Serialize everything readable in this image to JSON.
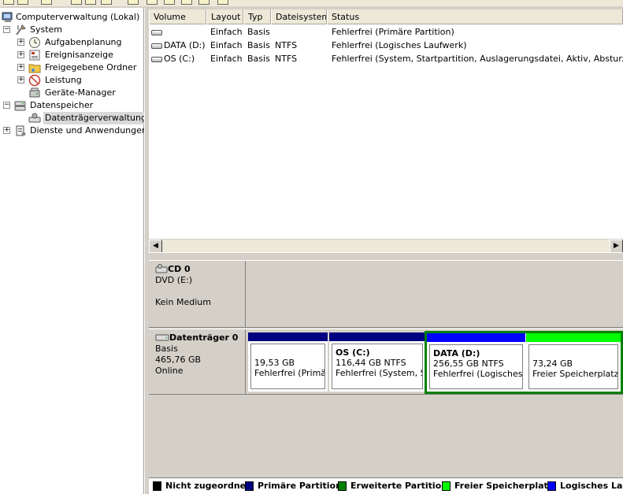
{
  "tree": {
    "root": "Computerverwaltung (Lokal)",
    "system": "System",
    "aufgaben": "Aufgabenplanung",
    "ereignis": "Ereignisanzeige",
    "freigabe": "Freigegebene Ordner",
    "leistung": "Leistung",
    "geraete": "Geräte-Manager",
    "datenspeicher": "Datenspeicher",
    "datentraeger": "Datenträgerverwaltung",
    "dienste": "Dienste und Anwendungen"
  },
  "columns": [
    "Volume",
    "Layout",
    "Typ",
    "Dateisystem",
    "Status"
  ],
  "volumes": [
    {
      "volume": "",
      "layout": "Einfach",
      "typ": "Basis",
      "fs": "",
      "status": "Fehlerfrei (Primäre Partition)"
    },
    {
      "volume": "DATA (D:)",
      "layout": "Einfach",
      "typ": "Basis",
      "fs": "NTFS",
      "status": "Fehlerfrei (Logisches Laufwerk)"
    },
    {
      "volume": "OS (C:)",
      "layout": "Einfach",
      "typ": "Basis",
      "fs": "NTFS",
      "status": "Fehlerfrei (System, Startpartition, Auslagerungsdatei, Aktiv, Absturzabbild, P"
    }
  ],
  "cd0": {
    "name": "CD 0",
    "line1": "DVD (E:)",
    "line2": "Kein Medium"
  },
  "disk0": {
    "name": "Datenträger 0",
    "type": "Basis",
    "size": "465,76 GB",
    "state": "Online"
  },
  "partitions": {
    "p1": {
      "size": "19,53 GB",
      "status": "Fehlerfrei (Primäre"
    },
    "p2": {
      "title": "OS  (C:)",
      "size": "116,44 GB NTFS",
      "status": "Fehlerfrei (System, St"
    },
    "p3": {
      "title": "DATA  (D:)",
      "size": "256,55 GB NTFS",
      "status": "Fehlerfrei (Logisches La"
    },
    "p4": {
      "size": "73,24 GB",
      "status": "Freier Speicherplatz"
    }
  },
  "legend": {
    "unallocated": "Nicht zugeordnet",
    "primary": "Primäre Partition",
    "extended": "Erweiterte Partition",
    "free": "Freier Speicherplatz",
    "logical": "Logisches Lauf"
  },
  "colors": {
    "primary": "#000080",
    "extended": "#008000",
    "free": "#00ff00",
    "logical": "#0000ff",
    "unallocated": "#000000"
  }
}
